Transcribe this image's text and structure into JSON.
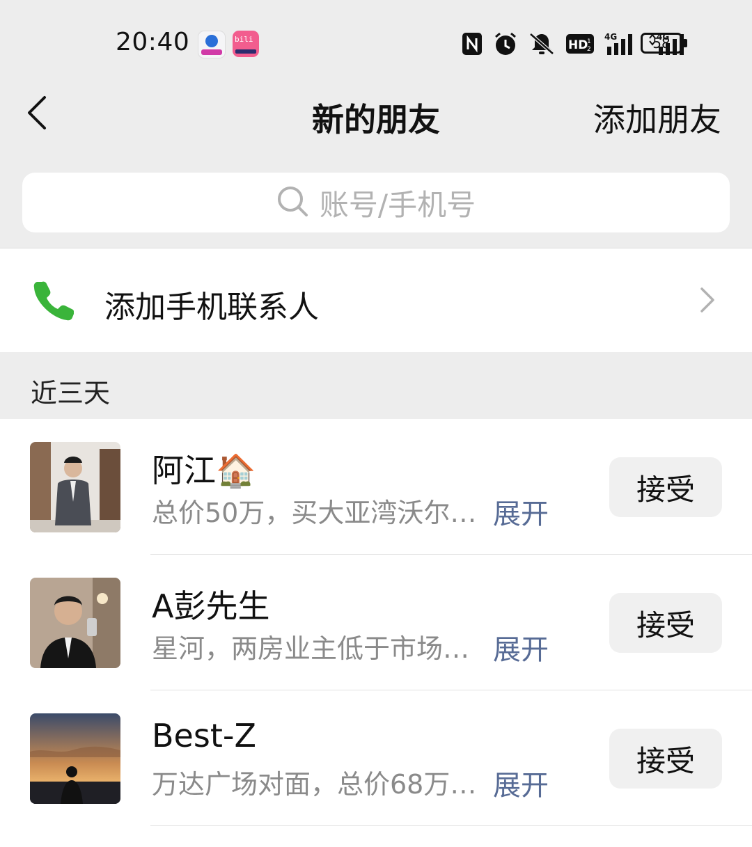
{
  "status_bar": {
    "time": "20:40",
    "battery": "58",
    "icons": [
      "nfc-icon",
      "alarm-icon",
      "mute-icon",
      "hd-icon",
      "signal-4g-icon",
      "signal-4g-icon"
    ]
  },
  "nav": {
    "title": "新的朋友",
    "action": "添加朋友"
  },
  "search": {
    "placeholder": "账号/手机号"
  },
  "add_contact": {
    "label": "添加手机联系人",
    "icon_color": "#3ab43a"
  },
  "section": {
    "title": "近三天"
  },
  "requests": [
    {
      "name": "阿江🏠",
      "desc": "总价50万，买大亚湾沃尔…",
      "expand": "展开",
      "accept": "接受"
    },
    {
      "name": "A彭先生",
      "desc": "星河，两房业主低于市场…",
      "expand": "展开",
      "accept": "接受"
    },
    {
      "name": "Best-Z",
      "desc": "万达广场对面，总价68万…",
      "expand": "展开",
      "accept": "接受"
    }
  ],
  "colors": {
    "background": "#ededed",
    "link": "#576b95",
    "accent_green": "#3ab43a"
  }
}
